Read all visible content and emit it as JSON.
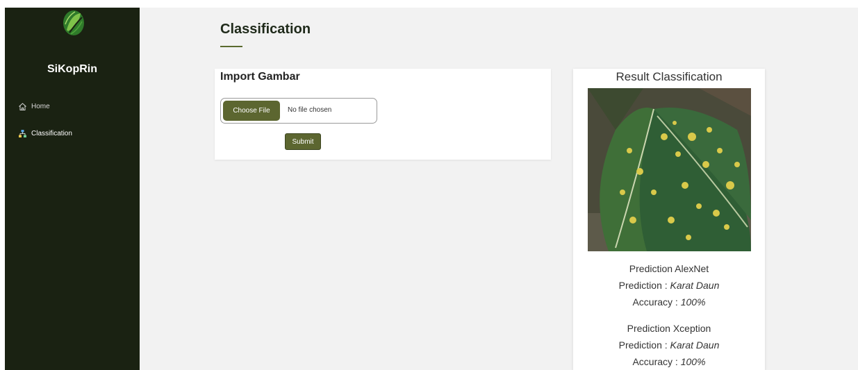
{
  "sidebar": {
    "brand": "SiKopRin",
    "items": [
      {
        "label": "Home",
        "icon": "home-icon"
      },
      {
        "label": "Classification",
        "icon": "hierarchy-icon"
      }
    ]
  },
  "main": {
    "title": "Classification",
    "import": {
      "title": "Import Gambar",
      "choose_label": "Choose File",
      "file_status": "No file chosen",
      "submit_label": "Submit"
    },
    "result": {
      "title": "Result Classification",
      "image_icon": "coffee-leaf-rust-photo",
      "predictions": [
        {
          "model": "Prediction AlexNet",
          "pred_label": "Prediction : ",
          "pred_value": "Karat Daun",
          "acc_label": "Accuracy : ",
          "acc_value": "100%"
        },
        {
          "model": "Prediction Xception",
          "pred_label": "Prediction : ",
          "pred_value": "Karat Daun",
          "acc_label": "Accuracy : ",
          "acc_value": "100%"
        }
      ]
    }
  },
  "colors": {
    "sidebar_bg": "#1a2212",
    "accent": "#5c6630",
    "page_bg": "#f2f2f2"
  }
}
